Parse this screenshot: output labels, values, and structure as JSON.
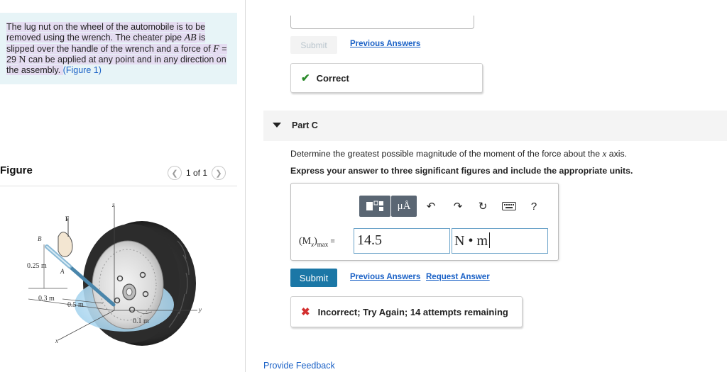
{
  "problem": {
    "seg1": "The lug nut on the wheel of the automobile is to be removed using the wrench. The cheater pipe ",
    "var_ab": "AB",
    "seg2": " is slipped over the handle of the wrench and a force of ",
    "var_f": "F",
    "seg3": " = 29 ",
    "unit_n": "N",
    "seg4": " can be applied at any point and in any direction on the assembly. ",
    "figure_link": "(Figure 1)"
  },
  "figure_panel": {
    "title": "Figure",
    "pager_text": "1 of 1",
    "prev_icon": "chevron-left-icon",
    "next_icon": "chevron-right-icon",
    "labels": {
      "z": "z",
      "F": "F",
      "B": "B",
      "A": "A",
      "d1": "0.25 m",
      "d2": "0.3 m",
      "d3": "0.5 m",
      "d4": "0.1 m",
      "y": "y",
      "x": "x"
    }
  },
  "previous_part": {
    "submit_label": "Submit",
    "previous_answers": "Previous Answers",
    "feedback": "Correct",
    "feedback_icon": "checkmark-icon"
  },
  "part_c": {
    "label": "Part C",
    "question_pre": "Determine the greatest possible magnitude of the moment of the force about the ",
    "question_var": "x",
    "question_post": " axis.",
    "instruction": "Express your answer to three significant figures and include the appropriate units.",
    "toolbar": [
      "templates-icon",
      "units-icon",
      "undo-icon",
      "redo-icon",
      "reset-icon",
      "keyboard-icon",
      "help-icon"
    ],
    "units_button_text": "μÅ",
    "help_text": "?",
    "eq_label_open": "(M",
    "eq_label_sub1": "x",
    "eq_label_close": ")",
    "eq_label_sub2": "max",
    "eq_label_eq": " = ",
    "value": "14.5",
    "units": "N • m",
    "submit_label": "Submit",
    "previous_answers": "Previous Answers",
    "request_answer": "Request Answer",
    "feedback": "Incorrect; Try Again; 14 attempts remaining",
    "feedback_icon": "x-mark-icon"
  },
  "footer": {
    "provide_feedback": "Provide Feedback"
  },
  "colors": {
    "problem_bg": "#e7f4f7",
    "highlight": "#e4dcf1",
    "link": "#1a61c6",
    "submit_bg": "#1b77a6",
    "correct_green": "#2a8a2a",
    "incorrect_red": "#d32f2f",
    "toolbar_dark": "#5a6673",
    "input_border": "#6ba3c9"
  }
}
